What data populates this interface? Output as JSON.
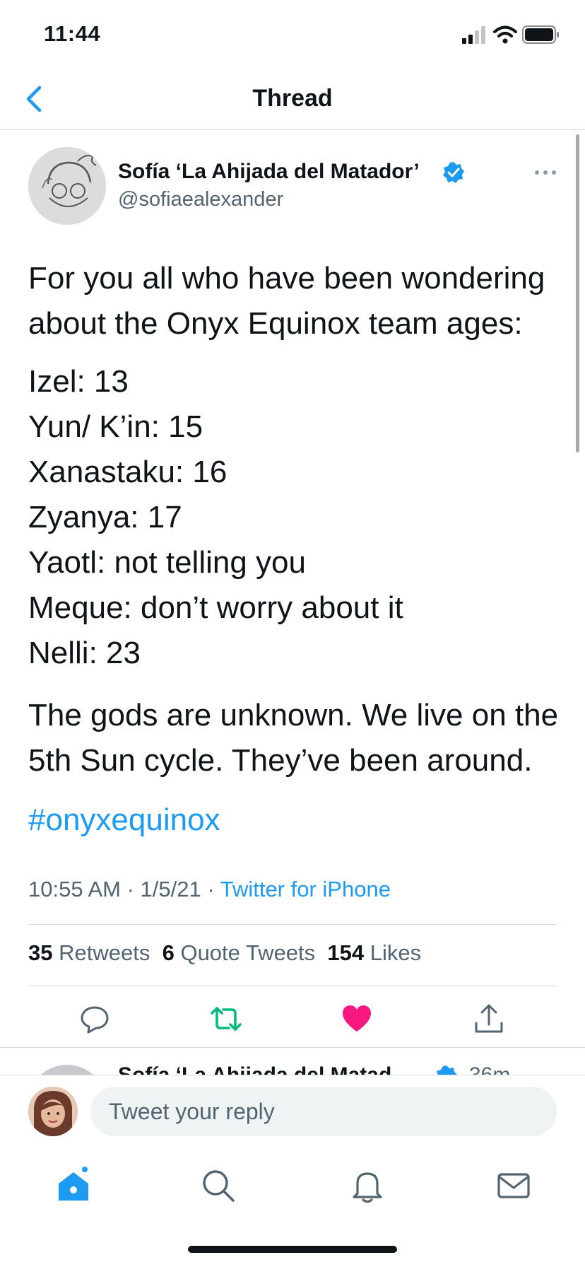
{
  "status_bar": {
    "time": "11:44"
  },
  "header": {
    "title": "Thread",
    "back_icon": "chevron-left-icon"
  },
  "tweet": {
    "display_name": "Sofía ‘La Ahijada del Matador’",
    "handle": "@sofiaealexander",
    "verified": true,
    "intro": "For you all who have been wondering about the Onyx Equinox team ages:",
    "ages": [
      "Izel: 13",
      "Yun/ K’in: 15",
      "Xanastaku: 16",
      "Zyanya: 17",
      "Yaotl: not telling you",
      "Meque: don’t worry about it",
      "Nelli: 23"
    ],
    "closing": "The gods are unknown. We live on the 5th Sun cycle. They’ve been around.",
    "hashtag": "#onyxequinox",
    "timestamp": "10:55 AM · 1/5/21 · ",
    "source": "Twitter for iPhone",
    "stats": {
      "retweets_count": "35",
      "retweets_label": "Retweets",
      "quotes_count": "6",
      "quotes_label": "Quote Tweets",
      "likes_count": "154",
      "likes_label": "Likes"
    },
    "liked": true
  },
  "next_tweet": {
    "display_name": "Sofía ‘La Ahijada del Matad",
    "time": "36m"
  },
  "reply": {
    "placeholder": "Tweet your reply"
  },
  "colors": {
    "accent": "#1d9bf0",
    "retweet": "#00ba7c",
    "like": "#f91880",
    "text": "#0f1419",
    "secondary": "#536471"
  },
  "tabs": [
    "home-icon",
    "search-icon",
    "bell-icon",
    "mail-icon"
  ]
}
